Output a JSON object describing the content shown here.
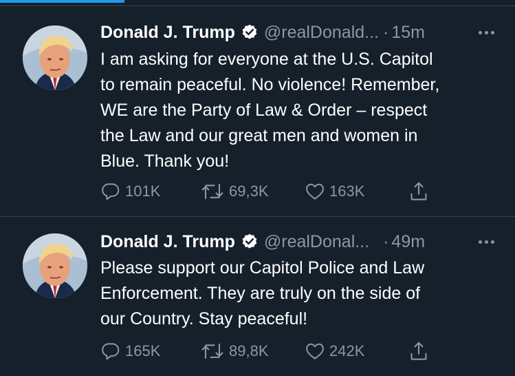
{
  "tweets": [
    {
      "name": "Donald J. Trump",
      "handle": "@realDonald...",
      "separator": "·",
      "time": "15m",
      "lines": [
        "I am asking for everyone at the U.S. Capitol",
        "to remain peaceful. No violence! Remember,",
        "WE are the Party of Law & Order – respect",
        "the Law and our great men and women in",
        "Blue. Thank you!"
      ],
      "replies": "101K",
      "retweets": "69,3K",
      "likes": "163K"
    },
    {
      "name": "Donald J. Trump",
      "handle": "@realDonal...",
      "separator": "·",
      "time": "49m",
      "lines": [
        "Please support our Capitol Police and Law",
        "Enforcement. They are truly on the side of",
        "our Country. Stay peaceful!"
      ],
      "replies": "165K",
      "retweets": "89,8K",
      "likes": "242K"
    }
  ],
  "icons": {
    "verified": "verified-badge-icon",
    "more": "more-options-icon",
    "reply": "reply-icon",
    "retweet": "retweet-icon",
    "like": "like-icon",
    "share": "share-icon"
  },
  "colors": {
    "background": "#15202b",
    "divider": "#38444d",
    "secondary_text": "#8899a6",
    "accent": "#1d9bf0"
  }
}
